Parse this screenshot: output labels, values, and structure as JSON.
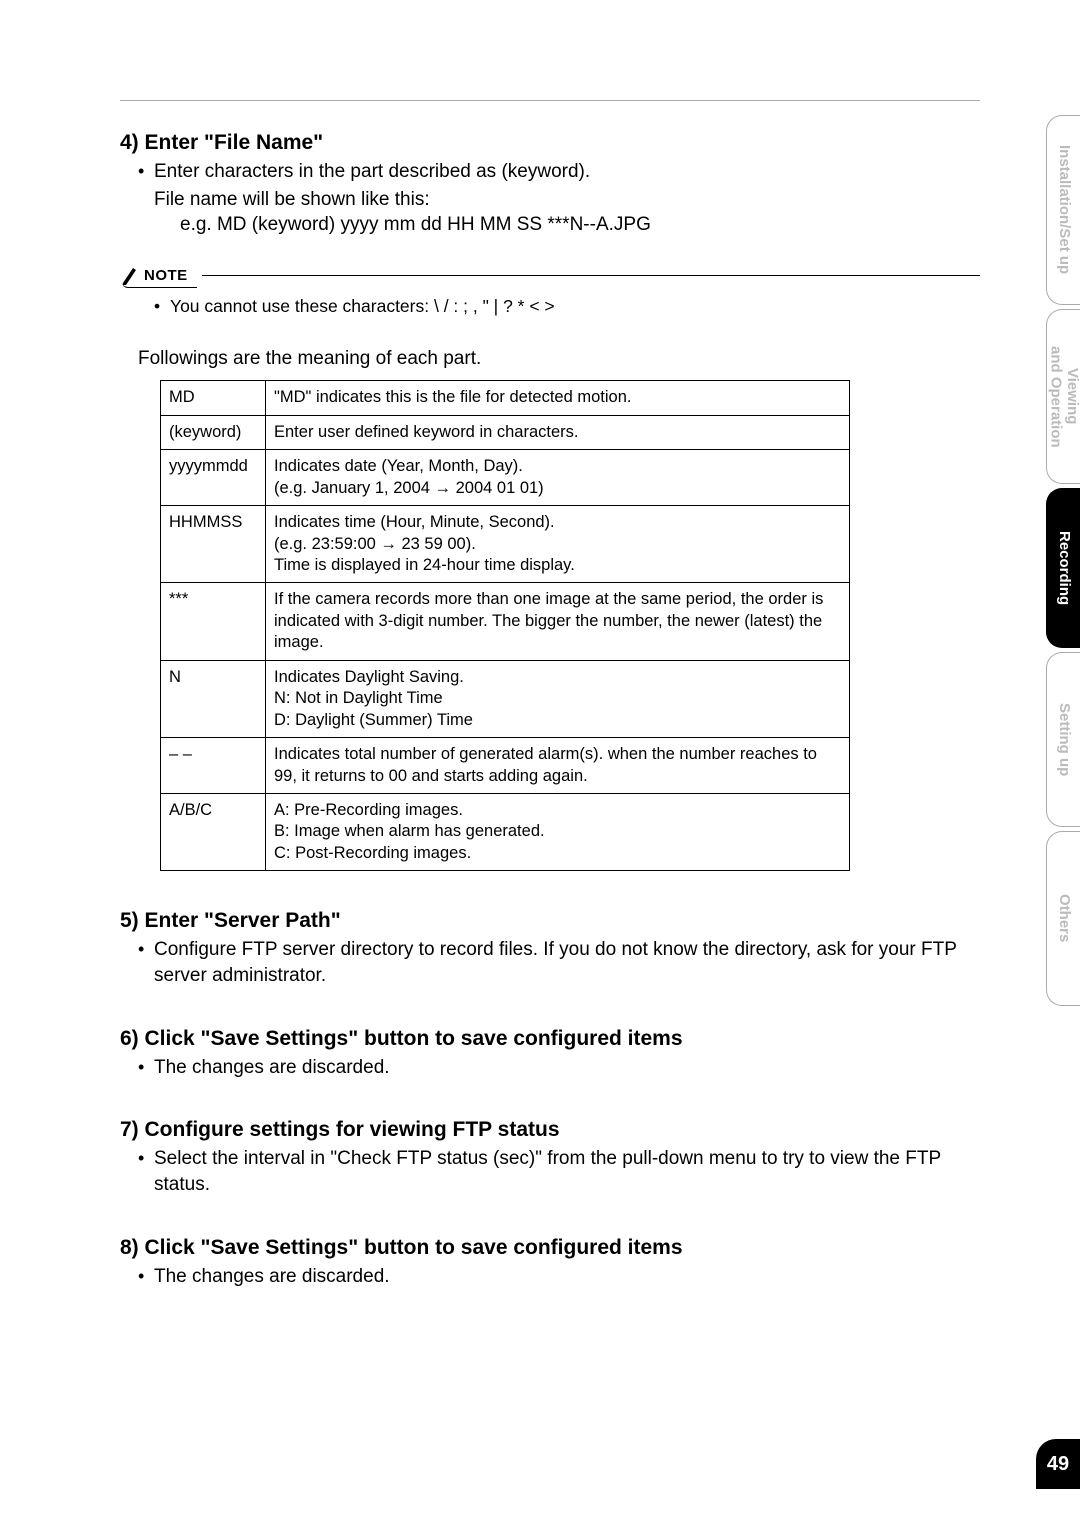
{
  "page_number": "49",
  "tabs": {
    "installation": "Installation/Set up",
    "viewing": "Viewing\nand Operation",
    "recording": "Recording",
    "setting": "Setting up",
    "others": "Others"
  },
  "section4": {
    "heading": "4) Enter \"File Name\"",
    "bullet1": "Enter characters in the part described as (keyword).",
    "line2": "File name will be shown like this:",
    "line3": "e.g. MD (keyword) yyyy mm dd HH MM SS ***N--A.JPG"
  },
  "note": {
    "label": "NOTE",
    "bullet": "You cannot use these characters: \\ / : ; , \" | ? * < >"
  },
  "followings": "Followings are the meaning of each part.",
  "table": [
    {
      "k": "MD",
      "v": "\"MD\" indicates this is the file for detected motion."
    },
    {
      "k": "(keyword)",
      "v": "Enter user defined keyword in characters."
    },
    {
      "k": "yyyymmdd",
      "v": "Indicates date (Year, Month, Day).\n(e.g. January 1, 2004 → 2004 01 01)"
    },
    {
      "k": "HHMMSS",
      "v": "Indicates time (Hour, Minute, Second).\n(e.g. 23:59:00 → 23 59 00).\nTime is displayed in 24-hour time display."
    },
    {
      "k": "***",
      "v": "If the camera records more than one image at the same period, the order is indicated with 3-digit number. The bigger the number, the newer (latest) the image."
    },
    {
      "k": "N",
      "v": "Indicates Daylight Saving.\nN: Not in Daylight Time\nD: Daylight (Summer) Time"
    },
    {
      "k": "– –",
      "v": "Indicates total number of generated alarm(s). when the number reaches to 99, it returns to 00 and starts adding again."
    },
    {
      "k": "A/B/C",
      "v": "A: Pre-Recording images.\nB: Image when alarm has generated.\nC: Post-Recording images."
    }
  ],
  "section5": {
    "heading": "5) Enter \"Server Path\"",
    "bullet": "Configure FTP server directory to record files. If you do not know the directory, ask for your FTP server administrator."
  },
  "section6": {
    "heading": "6) Click \"Save Settings\" button to save configured items",
    "bullet": "The changes are discarded."
  },
  "section7": {
    "heading": "7) Configure settings for viewing FTP status",
    "bullet": "Select the interval in \"Check FTP status (sec)\" from the pull-down menu to try to view the FTP status."
  },
  "section8": {
    "heading": "8) Click \"Save Settings\" button to save configured items",
    "bullet": "The changes are discarded."
  }
}
